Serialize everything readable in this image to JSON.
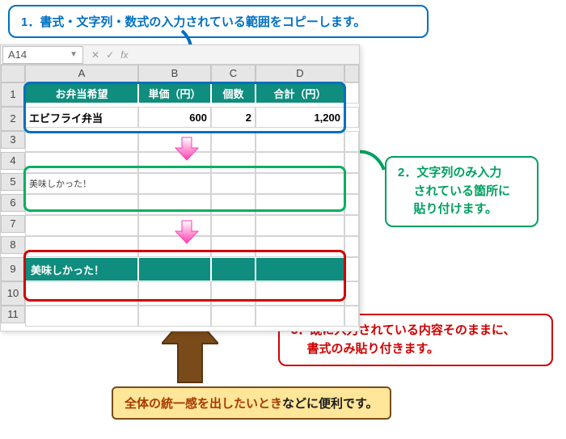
{
  "callouts": {
    "step1": "1．書式・文字列・数式の入力されている範囲をコピーします。",
    "step2_l1": "2．文字列のみ入力",
    "step2_l2": "されている箇所に",
    "step2_l3": "貼り付けます。",
    "step3_l1": "3．既に入力されている内容そのままに、",
    "step3_l2": "書式のみ貼り付きます。",
    "tip_a": "全体の統一感を出したいとき",
    "tip_b": "などに便利です。"
  },
  "namebox": "A14",
  "col_headers": {
    "A": "A",
    "B": "B",
    "C": "C",
    "D": "D"
  },
  "rows": [
    "1",
    "2",
    "3",
    "4",
    "5",
    "6",
    "7",
    "8",
    "9",
    "10",
    "11"
  ],
  "table": {
    "h_item": "お弁当希望",
    "h_price": "単価（円）",
    "h_qty": "個数",
    "h_total": "合計（円）",
    "item": "エビフライ弁当",
    "price": "600",
    "qty": "2",
    "total": "1,200"
  },
  "row5_text": "美味しかった！",
  "row9_text": "美味しかった！",
  "fx": {
    "cancel": "✕",
    "commit": "✓",
    "func": "fx"
  },
  "chart_data": null
}
